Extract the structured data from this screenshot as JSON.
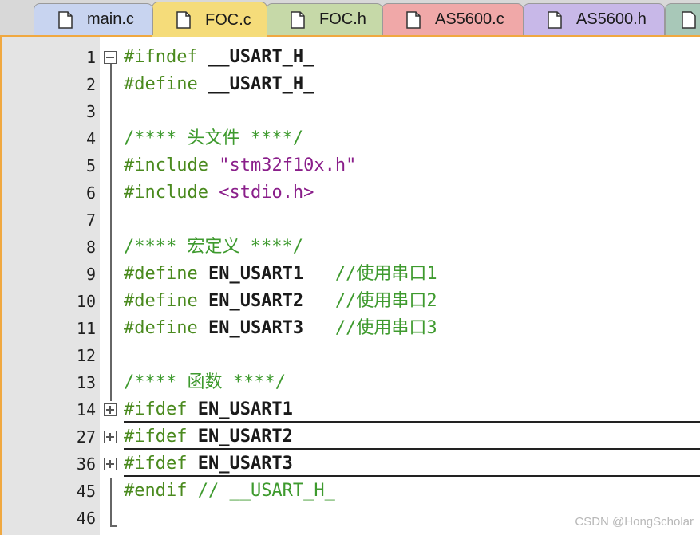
{
  "tabs": [
    {
      "label": "main.c",
      "color": "#c8d4f0"
    },
    {
      "label": "FOC.c",
      "color": "#f5dc7a"
    },
    {
      "label": "FOC.h",
      "color": "#c6d9a8"
    },
    {
      "label": "AS5600.c",
      "color": "#f0a8a8"
    },
    {
      "label": "AS5600.h",
      "color": "#c8b8e8"
    }
  ],
  "editor": {
    "lines": [
      {
        "num": "1",
        "fold": "minus",
        "parts": [
          {
            "c": "kw",
            "t": "#ifndef "
          },
          {
            "c": "def",
            "t": "__USART_H_"
          }
        ]
      },
      {
        "num": "2",
        "parts": [
          {
            "c": "kw",
            "t": "#define "
          },
          {
            "c": "def",
            "t": "__USART_H_"
          }
        ]
      },
      {
        "num": "3",
        "parts": []
      },
      {
        "num": "4",
        "parts": [
          {
            "c": "cmt",
            "t": "/**** 头文件 ****/"
          }
        ]
      },
      {
        "num": "5",
        "parts": [
          {
            "c": "kw",
            "t": "#include "
          },
          {
            "c": "str",
            "t": "\"stm32f10x.h\""
          }
        ]
      },
      {
        "num": "6",
        "parts": [
          {
            "c": "kw",
            "t": "#include "
          },
          {
            "c": "str",
            "t": "<stdio.h>"
          }
        ]
      },
      {
        "num": "7",
        "parts": []
      },
      {
        "num": "8",
        "parts": [
          {
            "c": "cmt",
            "t": "/**** 宏定义 ****/"
          }
        ]
      },
      {
        "num": "9",
        "parts": [
          {
            "c": "kw",
            "t": "#define "
          },
          {
            "c": "def",
            "t": "EN_USART1"
          },
          {
            "c": "cmt",
            "t": "   //使用串口1"
          }
        ]
      },
      {
        "num": "10",
        "parts": [
          {
            "c": "kw",
            "t": "#define "
          },
          {
            "c": "def",
            "t": "EN_USART2"
          },
          {
            "c": "cmt",
            "t": "   //使用串口2"
          }
        ]
      },
      {
        "num": "11",
        "parts": [
          {
            "c": "kw",
            "t": "#define "
          },
          {
            "c": "def",
            "t": "EN_USART3"
          },
          {
            "c": "cmt",
            "t": "   //使用串口3"
          }
        ]
      },
      {
        "num": "12",
        "parts": []
      },
      {
        "num": "13",
        "parts": [
          {
            "c": "cmt",
            "t": "/**** 函数 ****/"
          }
        ]
      },
      {
        "num": "14",
        "fold": "plus",
        "collapsed": true,
        "parts": [
          {
            "c": "kw",
            "t": "#ifdef "
          },
          {
            "c": "def",
            "t": "EN_USART1"
          }
        ]
      },
      {
        "num": "27",
        "fold": "plus",
        "collapsed": true,
        "parts": [
          {
            "c": "kw",
            "t": "#ifdef "
          },
          {
            "c": "def",
            "t": "EN_USART2"
          }
        ]
      },
      {
        "num": "36",
        "fold": "plus",
        "collapsed": true,
        "parts": [
          {
            "c": "kw",
            "t": "#ifdef "
          },
          {
            "c": "def",
            "t": "EN_USART3"
          }
        ]
      },
      {
        "num": "45",
        "parts": [
          {
            "c": "kw",
            "t": "#endif "
          },
          {
            "c": "cmt",
            "t": "// __USART_H_"
          }
        ]
      },
      {
        "num": "46",
        "parts": []
      }
    ]
  },
  "watermark": "CSDN @HongScholar"
}
